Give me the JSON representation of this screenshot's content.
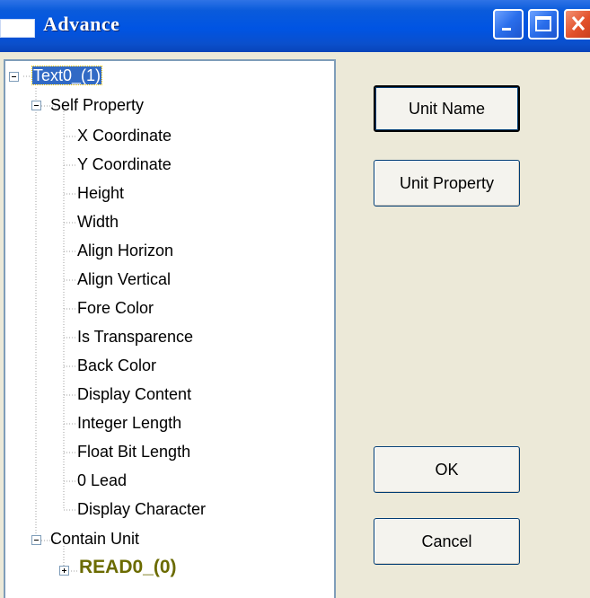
{
  "window": {
    "title": "Advance"
  },
  "tree": {
    "root": {
      "label": "Text0_(1)"
    },
    "self_property": {
      "label": "Self Property",
      "items": [
        "X Coordinate",
        "Y Coordinate",
        "Height",
        "Width",
        "Align Horizon",
        "Align Vertical",
        "Fore Color",
        "Is Transparence",
        "Back Color",
        "Display Content",
        "Integer Length",
        "Float Bit Length",
        "0 Lead",
        "Display Character"
      ]
    },
    "contain_unit": {
      "label": "Contain Unit",
      "child": {
        "label": "READ0_(0)"
      }
    }
  },
  "buttons": {
    "unit_name": "Unit Name",
    "unit_property": "Unit Property",
    "ok": "OK",
    "cancel": "Cancel"
  },
  "colors": {
    "titlebar": "#0054E3",
    "dialog_bg": "#ECE9D8",
    "selection": "#316AC5",
    "read0_text": "#6B6B00"
  }
}
